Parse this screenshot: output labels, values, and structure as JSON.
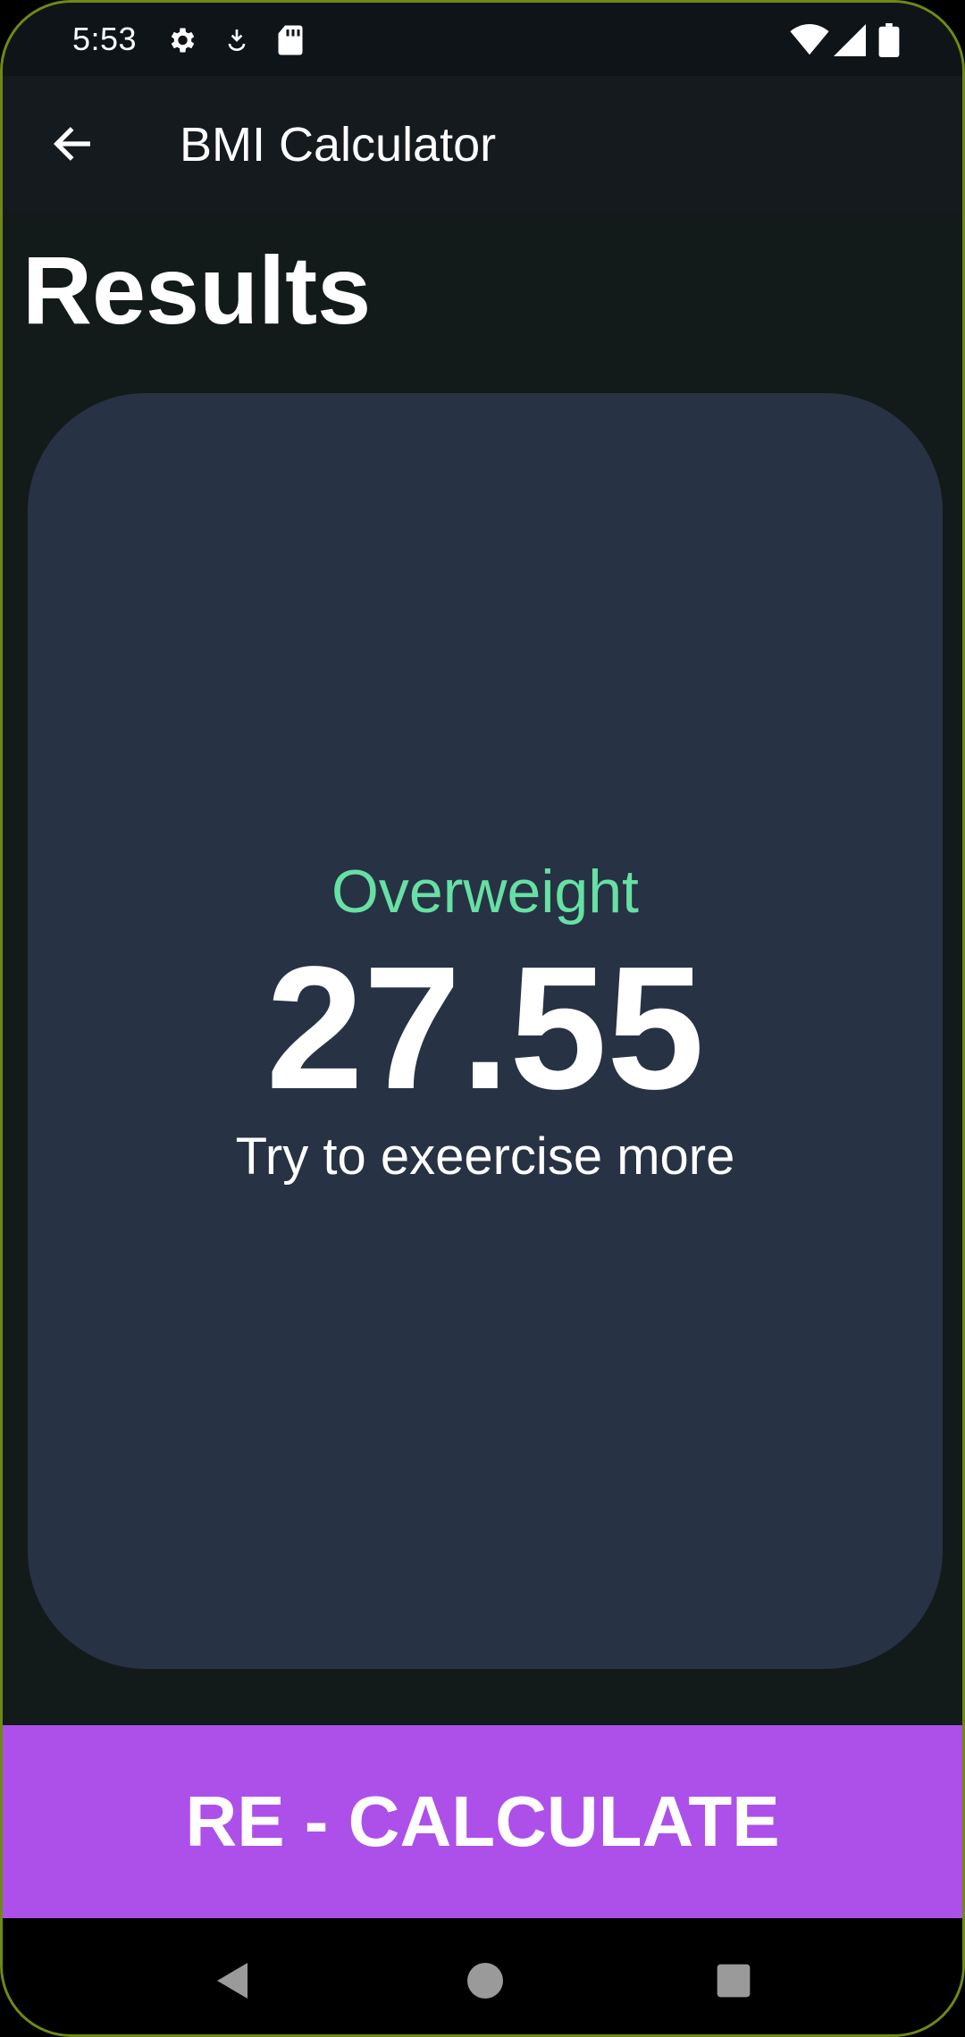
{
  "status_bar": {
    "time": "5:53",
    "icons_left": [
      "gear-icon",
      "download-icon",
      "sd-card-icon"
    ],
    "icons_right": [
      "wifi-icon",
      "cell-signal-icon",
      "battery-icon"
    ]
  },
  "app_bar": {
    "title": "BMI Calculator",
    "back_icon": "arrow-back-icon"
  },
  "page": {
    "title": "Results"
  },
  "result": {
    "status": "Overweight",
    "value": "27.55",
    "advice": "Try to exeercise more"
  },
  "actions": {
    "recalculate_label": "RE - CALCULATE"
  },
  "nav_bar": {
    "buttons": [
      "back-triangle-icon",
      "home-circle-icon",
      "recents-square-icon"
    ]
  },
  "colors": {
    "background": "#131a1a",
    "app_bar": "#151a1f",
    "card": "#273244",
    "status_text": "#66e0a3",
    "accent_button": "#ad50ea",
    "text": "#ffffff"
  }
}
